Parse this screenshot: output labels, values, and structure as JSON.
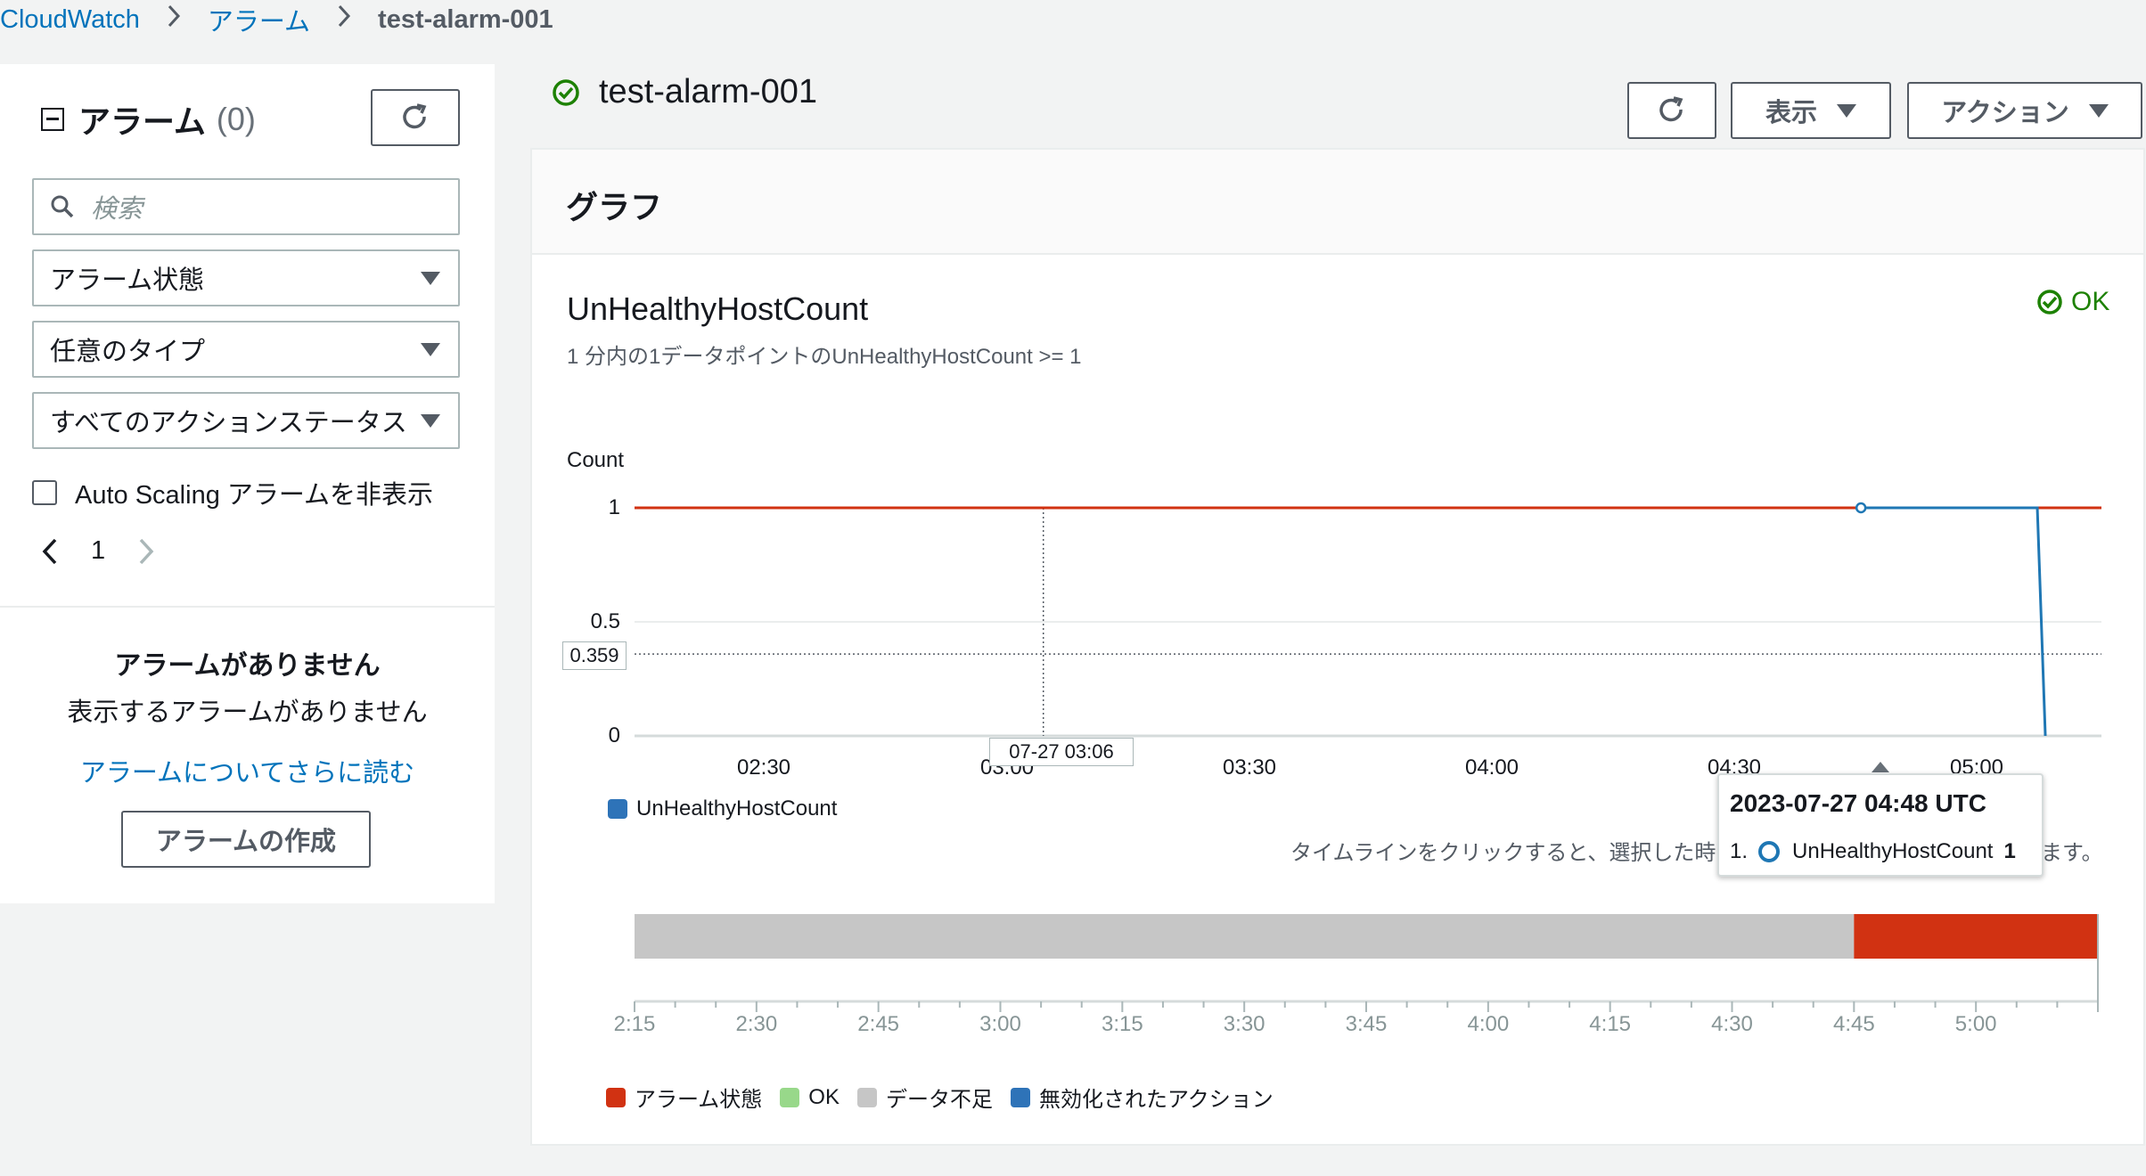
{
  "breadcrumb": {
    "root": "CloudWatch",
    "section": "アラーム",
    "current": "test-alarm-001"
  },
  "sidebar": {
    "title": "アラーム",
    "count": "(0)",
    "search_placeholder": "検索",
    "filters": {
      "state": "アラーム状態",
      "type": "任意のタイプ",
      "action_status": "すべてのアクションステータス"
    },
    "hide_autoscaling": "Auto Scaling アラームを非表示",
    "page": "1",
    "empty_title": "アラームがありません",
    "empty_sub": "表示するアラームがありません",
    "learn_more": "アラームについてさらに読む",
    "create_button": "アラームの作成"
  },
  "header": {
    "alarm_name": "test-alarm-001",
    "view_button": "表示",
    "action_button": "アクション"
  },
  "panel": {
    "section_title": "グラフ",
    "metric_title": "UnHealthyHostCount",
    "metric_sub": "1 分内の1データポイントのUnHealthyHostCount >= 1",
    "status": "OK",
    "hint_text": "タイムラインをクリックすると、選択した時",
    "hint_tail": "ます。",
    "crosshair_time": "07-27 03:06",
    "crosshair_value": "0.359",
    "tooltip": {
      "time": "2023-07-27 04:48 UTC",
      "index": "1.",
      "series": "UnHealthyHostCount",
      "value": "1"
    }
  },
  "chart_data": {
    "type": "line",
    "ylabel": "Count",
    "ylim": [
      0,
      1
    ],
    "y_ticks": [
      "1",
      "0.5",
      "0"
    ],
    "x_ticks": [
      "02:30",
      "03:00",
      "03:30",
      "04:00",
      "04:30",
      "05:00"
    ],
    "threshold": 1,
    "series": [
      {
        "name": "UnHealthyHostCount",
        "color": "#1f77b4",
        "points": [
          {
            "x": "04:48",
            "y": 1
          },
          {
            "x": "05:10",
            "y": 1
          },
          {
            "x": "05:11",
            "y": 0
          }
        ]
      }
    ],
    "threshold_color": "#d13212"
  },
  "timeline": {
    "ticks": [
      "2:15",
      "2:30",
      "2:45",
      "3:00",
      "3:15",
      "3:30",
      "3:45",
      "4:00",
      "4:15",
      "4:30",
      "4:45",
      "5:00"
    ],
    "segments": [
      {
        "state": "insufficient",
        "from": "2:15",
        "to": "4:45",
        "color": "#c6c6c6"
      },
      {
        "state": "alarm",
        "from": "4:45",
        "to": "5:15",
        "color": "#d13212"
      }
    ]
  },
  "legend": [
    {
      "label": "アラーム状態",
      "color": "#d13212"
    },
    {
      "label": "OK",
      "color": "#98d88a"
    },
    {
      "label": "データ不足",
      "color": "#c6c6c6"
    },
    {
      "label": "無効化されたアクション",
      "color": "#2e73b8"
    }
  ]
}
